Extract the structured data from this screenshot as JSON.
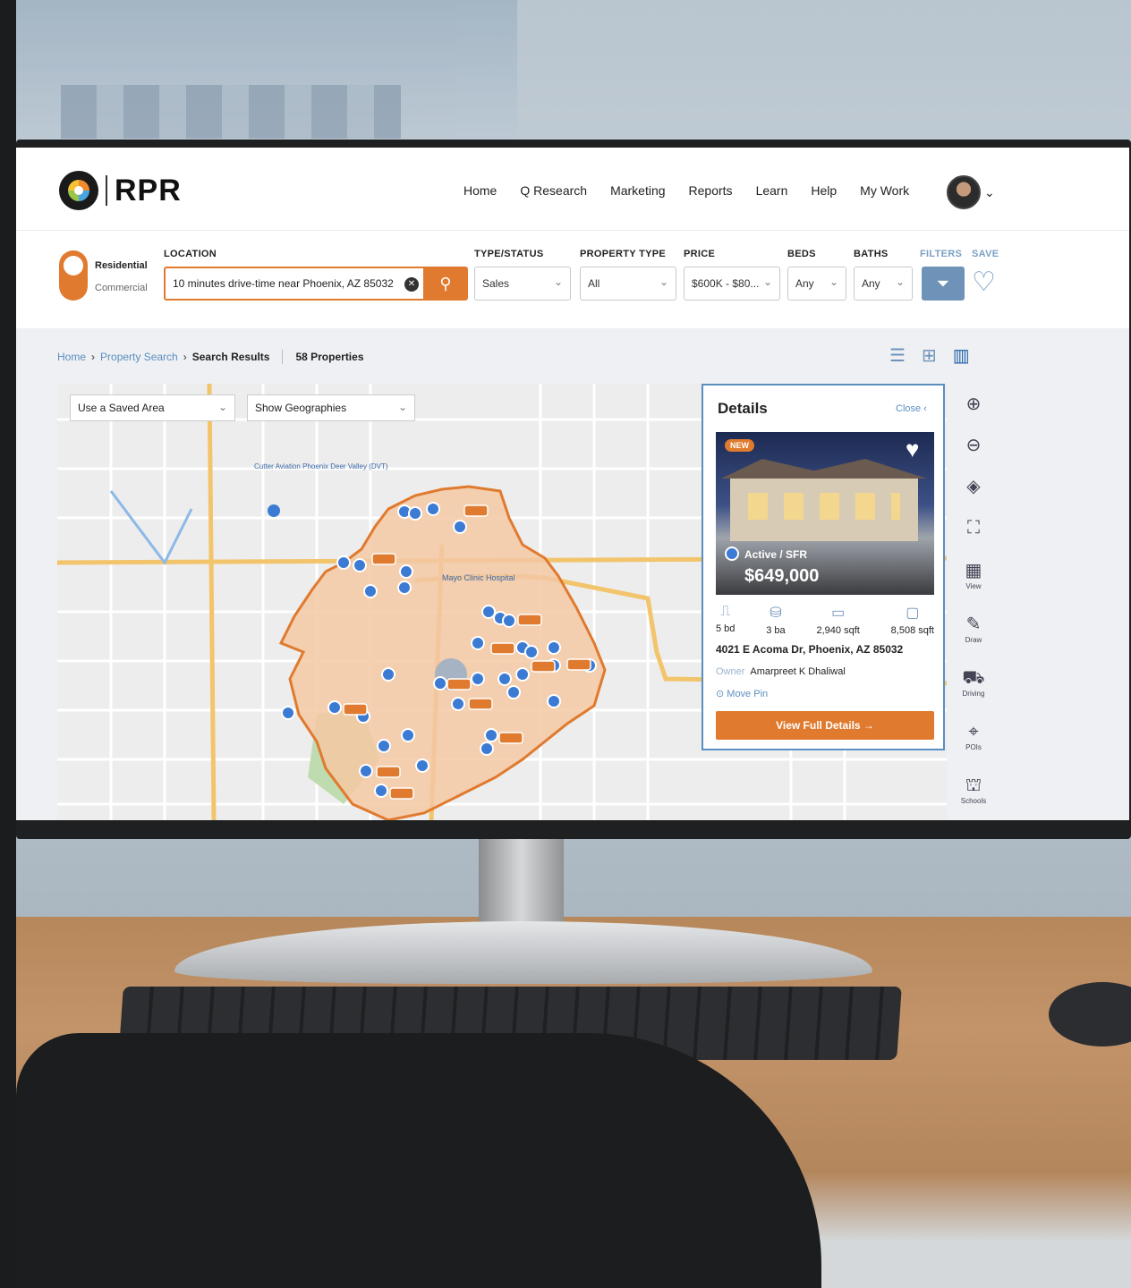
{
  "nav": {
    "brand": "RPR",
    "links": [
      "Home",
      "Q Research",
      "Marketing",
      "Reports",
      "Learn",
      "Help",
      "My Work"
    ]
  },
  "search": {
    "toggle": {
      "on": "Residential",
      "off": "Commercial"
    },
    "location_label": "LOCATION",
    "location_value": "10 minutes drive-time near Phoenix, AZ 85032",
    "type_status": {
      "label": "TYPE/STATUS",
      "value": "Sales"
    },
    "property_type": {
      "label": "PROPERTY TYPE",
      "value": "All"
    },
    "price": {
      "label": "PRICE",
      "value": "$600K - $80..."
    },
    "beds": {
      "label": "BEDS",
      "value": "Any"
    },
    "baths": {
      "label": "BATHS",
      "value": "Any"
    },
    "filters_label": "FILTERS",
    "save_label": "SAVE"
  },
  "breadcrumb": {
    "home": "Home",
    "property_search": "Property Search",
    "current": "Search Results",
    "count": "58 Properties"
  },
  "map": {
    "saved_area": "Use a Saved Area",
    "geographies": "Show Geographies",
    "poi_label": "Cutter Aviation Phoenix Deer Valley (DVT)",
    "hospital_label": "Mayo Clinic Hospital"
  },
  "details": {
    "title": "Details",
    "close": "Close",
    "badge": "NEW",
    "status": "Active / SFR",
    "price": "$649,000",
    "beds": "5 bd",
    "baths": "3 ba",
    "sqft": "2,940 sqft",
    "lot": "8,508 sqft",
    "address": "4021 E Acoma Dr, Phoenix, AZ 85032",
    "owner_label": "Owner",
    "owner": "Amarpreet K Dhaliwal",
    "move_pin": "Move Pin",
    "cta": "View Full Details →"
  },
  "tools": {
    "view": "View",
    "draw": "Draw",
    "driving": "Driving",
    "pois": "POIs",
    "schools": "Schools"
  },
  "colors": {
    "accent": "#e07a2e",
    "blue": "#3b7bd4",
    "nav_blue": "#6f93b8"
  }
}
